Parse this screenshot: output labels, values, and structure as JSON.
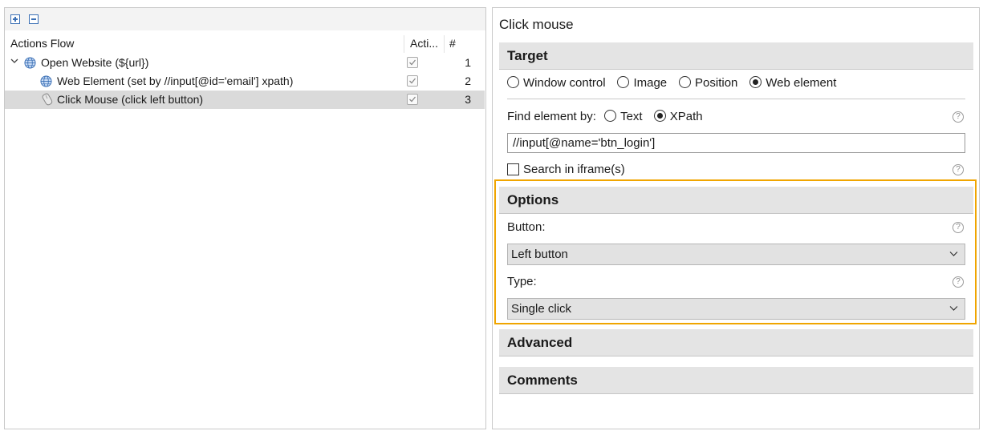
{
  "left": {
    "toolbar": {
      "expand_icon": "plus-box-icon",
      "collapse_icon": "minus-box-icon"
    },
    "columns": {
      "name": "Actions Flow",
      "active": "Acti...",
      "number": "#"
    },
    "rows": [
      {
        "label": "Open Website (${url})",
        "icon": "globe-icon",
        "expanded": true,
        "checked": true,
        "num": "1"
      },
      {
        "label": "Web Element (set by //input[@id='email'] xpath)",
        "icon": "globe-icon",
        "checked": true,
        "num": "2"
      },
      {
        "label": "Click Mouse (click left button)",
        "icon": "mouse-icon",
        "checked": true,
        "num": "3",
        "selected": true
      }
    ]
  },
  "right": {
    "title": "Click mouse",
    "target": {
      "heading": "Target",
      "radios": [
        {
          "label": "Window control",
          "selected": false
        },
        {
          "label": "Image",
          "selected": false
        },
        {
          "label": "Position",
          "selected": false
        },
        {
          "label": "Web element",
          "selected": true
        }
      ],
      "find_by_label": "Find element by:",
      "find_by_options": [
        {
          "label": "Text",
          "selected": false
        },
        {
          "label": "XPath",
          "selected": true
        }
      ],
      "xpath_value": "//input[@name='btn_login']",
      "iframe_label": "Search in iframe(s)",
      "iframe_checked": false
    },
    "options": {
      "heading": "Options",
      "button_label": "Button:",
      "button_value": "Left button",
      "type_label": "Type:",
      "type_value": "Single click",
      "highlight_color": "#f0a500"
    },
    "advanced": {
      "heading": "Advanced"
    },
    "comments": {
      "heading": "Comments"
    },
    "help_glyph": "?"
  }
}
